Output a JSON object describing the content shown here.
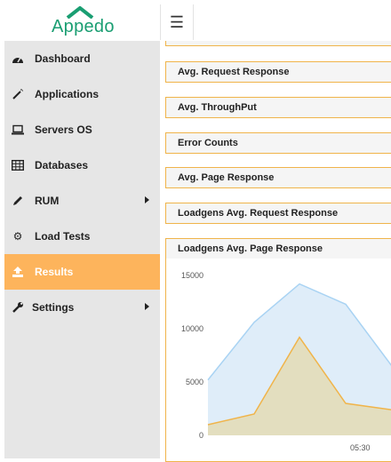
{
  "brand": {
    "name": "Appedo",
    "color": "#1a9e72"
  },
  "topbar": {
    "menu_icon": "hamburger-icon"
  },
  "sidebar": {
    "items": [
      {
        "label": "Dashboard",
        "icon": "dashboard-icon",
        "submenu": false,
        "active": false
      },
      {
        "label": "Applications",
        "icon": "magic-wand-icon",
        "submenu": false,
        "active": false
      },
      {
        "label": "Servers OS",
        "icon": "laptop-icon",
        "submenu": false,
        "active": false
      },
      {
        "label": "Databases",
        "icon": "table-icon",
        "submenu": false,
        "active": false
      },
      {
        "label": "RUM",
        "icon": "pencil-icon",
        "submenu": true,
        "active": false
      },
      {
        "label": "Load Tests",
        "icon": "gear-icon",
        "submenu": false,
        "active": false
      },
      {
        "label": "Results",
        "icon": "upload-icon",
        "submenu": false,
        "active": true
      },
      {
        "label": "Settings",
        "icon": "wrench-icon",
        "submenu": true,
        "active": false
      }
    ],
    "active_color": "#fdb45c"
  },
  "panels": [
    {
      "title": "Avg. Request Response"
    },
    {
      "title": "Avg. ThroughPut"
    },
    {
      "title": "Error Counts"
    },
    {
      "title": "Avg. Page Response"
    },
    {
      "title": "Loadgens Avg. Request Response"
    }
  ],
  "chart_panel": {
    "title": "Loadgens Avg. Page Response"
  },
  "chart_data": {
    "type": "area",
    "yticks": [
      "15000",
      "10000",
      "5000",
      "0"
    ],
    "xticks": [
      "05:30"
    ],
    "ylim": [
      0,
      15000
    ],
    "grid": false,
    "series": [
      {
        "values": [
          5200,
          10600,
          14200,
          12300,
          6500
        ],
        "color": "#a9d3f3",
        "fill": "#dcebf8"
      },
      {
        "values": [
          1000,
          2000,
          9200,
          3000,
          2400
        ],
        "color": "#f0b44a",
        "fill": "#e3dcb8"
      }
    ]
  }
}
